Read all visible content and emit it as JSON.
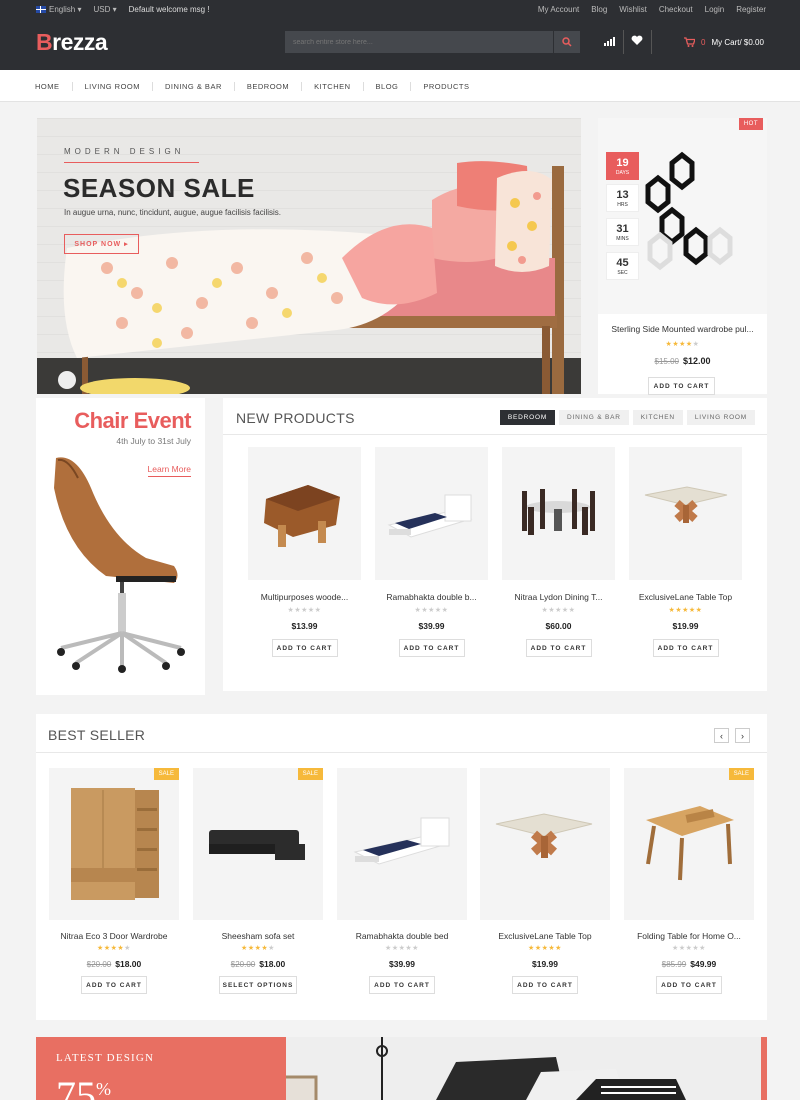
{
  "header": {
    "language": "English",
    "currency": "USD",
    "welcome": "Default welcome msg !",
    "links": [
      "My Account",
      "Blog",
      "Wishlist",
      "Checkout",
      "Login",
      "Register"
    ],
    "logo_first": "B",
    "logo_rest": "rezza",
    "search_placeholder": "search entire store here...",
    "cart_count": "0",
    "cart_label": "My Cart/ $0.00"
  },
  "nav": [
    "HOME",
    "LIVING ROOM",
    "DINING & BAR",
    "BEDROOM",
    "KITCHEN",
    "BLOG",
    "PRODUCTS"
  ],
  "hero": {
    "eyebrow": "MODERN DESIGN",
    "title": "SEASON SALE",
    "subtitle": "In augue urna, nunc, tincidunt, augue, augue facilisis facilisis.",
    "button": "SHOP NOW"
  },
  "hot_deal": {
    "badge": "HOT",
    "countdown": [
      {
        "value": "19",
        "unit": "DAYS"
      },
      {
        "value": "13",
        "unit": "HRS"
      },
      {
        "value": "31",
        "unit": "MINS"
      },
      {
        "value": "45",
        "unit": "SEC"
      }
    ],
    "name": "Sterling Side Mounted wardrobe pul...",
    "rating": 4,
    "old_price": "$15.00",
    "price": "$12.00",
    "button": "ADD TO CART"
  },
  "chair_banner": {
    "title": "Chair Event",
    "date": "4th July to 31st July",
    "link": "Learn More"
  },
  "new_products": {
    "title": "NEW PRODUCTS",
    "tabs": [
      "BEDROOM",
      "DINING & BAR",
      "KITCHEN",
      "LIVING ROOM"
    ],
    "items": [
      {
        "name": "Multipurposes woode...",
        "rating": 0,
        "price": "$13.99",
        "button": "ADD TO CART"
      },
      {
        "name": "Ramabhakta double b...",
        "rating": 0,
        "price": "$39.99",
        "button": "ADD TO CART"
      },
      {
        "name": "Nitraa Lydon Dining T...",
        "rating": 0,
        "price": "$60.00",
        "button": "ADD TO CART"
      },
      {
        "name": "ExclusiveLane Table Top",
        "rating": 5,
        "price": "$19.99",
        "button": "ADD TO CART"
      }
    ]
  },
  "best_seller": {
    "title": "BEST SELLER",
    "items": [
      {
        "name": "Nitraa Eco 3 Door Wardrobe",
        "badge": "SALE",
        "rating": 4,
        "old_price": "$20.00",
        "price": "$18.00",
        "button": "ADD TO CART"
      },
      {
        "name": "Sheesham sofa set",
        "badge": "SALE",
        "rating": 4,
        "old_price": "$20.00",
        "price": "$18.00",
        "button": "SELECT OPTIONS"
      },
      {
        "name": "Ramabhakta double bed",
        "badge": "",
        "rating": 0,
        "old_price": "",
        "price": "$39.99",
        "button": "ADD TO CART"
      },
      {
        "name": "ExclusiveLane Table Top",
        "badge": "",
        "rating": 5,
        "old_price": "",
        "price": "$19.99",
        "button": "ADD TO CART"
      },
      {
        "name": "Folding Table for Home O...",
        "badge": "SALE",
        "rating": 0,
        "old_price": "$85.99",
        "price": "$49.99",
        "button": "ADD TO CART"
      }
    ]
  },
  "promo": {
    "eyebrow": "LATEST DESIGN",
    "big": "75",
    "percent": "%"
  },
  "colors": {
    "accent": "#e85d5d",
    "dark": "#2d2f33",
    "star": "#f6b93b"
  }
}
